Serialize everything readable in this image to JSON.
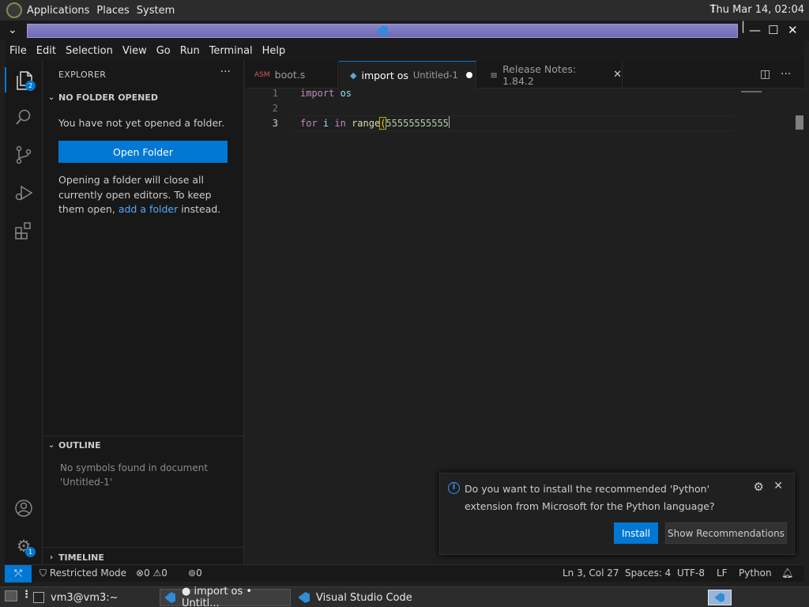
{
  "top_panel": {
    "menus": [
      "Applications",
      "Places",
      "System"
    ],
    "clock": "Thu Mar 14, 02:04"
  },
  "window": {
    "menu_toggle_icon": "chevron-down-icon",
    "controls": [
      "minimize-icon",
      "maximize-icon",
      "close-icon"
    ]
  },
  "menubar": {
    "items": [
      "File",
      "Edit",
      "Selection",
      "View",
      "Go",
      "Run",
      "Terminal",
      "Help"
    ]
  },
  "activity_bar": {
    "items": [
      {
        "icon": "explorer-icon",
        "badge": "2"
      },
      {
        "icon": "search-icon"
      },
      {
        "icon": "source-control-icon"
      },
      {
        "icon": "run-debug-icon"
      },
      {
        "icon": "extensions-icon"
      }
    ],
    "bottom": [
      {
        "icon": "account-icon"
      },
      {
        "icon": "manage-gear-icon",
        "badge": "1"
      }
    ]
  },
  "sidebar": {
    "title": "EXPLORER",
    "more": "···",
    "no_folder_header": "NO FOLDER OPENED",
    "no_folder_msg": "You have not yet opened a folder.",
    "open_folder_label": "Open Folder",
    "info_pre": "Opening a folder will close all currently open editors. To keep them open, ",
    "info_link": "add a folder",
    "info_post": " instead.",
    "outline_header": "OUTLINE",
    "outline_msg": "No symbols found in document 'Untitled-1'",
    "timeline_header": "TIMELINE"
  },
  "tabs": [
    {
      "label": "boot.s",
      "icon": "asm-file-icon",
      "dirty": true
    },
    {
      "label": "import os",
      "description": "Untitled-1",
      "icon": "python-file-icon",
      "dirty": true,
      "active": true
    },
    {
      "label": "Release Notes: 1.84.2",
      "icon": "release-notes-icon",
      "closable": true
    }
  ],
  "editor": {
    "lines": [
      {
        "num": "1",
        "tokens": [
          {
            "t": "import",
            "c": "kw"
          },
          {
            "t": " os",
            "c": "id"
          }
        ]
      },
      {
        "num": "2",
        "tokens": []
      },
      {
        "num": "3",
        "tokens": [
          {
            "t": "for",
            "c": "kw"
          },
          {
            "t": " i ",
            "c": "id"
          },
          {
            "t": "in",
            "c": "kw"
          },
          {
            "t": " ",
            "c": "id"
          },
          {
            "t": "range",
            "c": "fn"
          }
        ]
      }
    ],
    "line3_number": "55555555555",
    "current_line": 3
  },
  "notification": {
    "message": "Do you want to install the recommended 'Python' extension from Microsoft for the Python language?",
    "install_label": "Install",
    "show_recommendations_label": "Show Recommendations"
  },
  "statusbar": {
    "restricted_mode": "Restricted Mode",
    "errors": "0",
    "warnings": "0",
    "ports": "0",
    "position": "Ln 3, Col 27",
    "spaces": "Spaces: 4",
    "encoding": "UTF-8",
    "eol": "LF",
    "language": "Python"
  },
  "taskbar": {
    "items": [
      {
        "label": "vm3@vm3:~",
        "icon": "terminal-icon"
      },
      {
        "label": "● import os • Untitl...",
        "icon": "vscode-icon",
        "active": true
      },
      {
        "label": "Visual Studio Code",
        "icon": "vscode-icon"
      }
    ]
  },
  "colors": {
    "accent": "#0078d4",
    "link": "#4daafc",
    "keyword": "#c586c0",
    "function": "#dcdcaa",
    "number": "#b5cea8"
  }
}
